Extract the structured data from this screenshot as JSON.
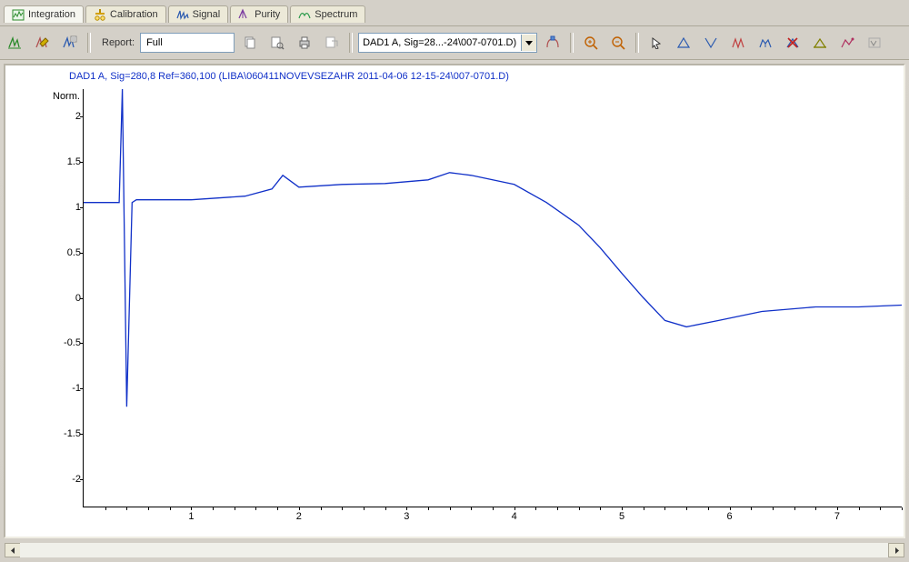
{
  "tabs": [
    {
      "label": "Integration",
      "active": true
    },
    {
      "label": "Calibration"
    },
    {
      "label": "Signal"
    },
    {
      "label": "Purity"
    },
    {
      "label": "Spectrum"
    }
  ],
  "toolbar": {
    "report_label": "Report:",
    "report_value": "Full",
    "signal_value": "DAD1 A, Sig=28...-24\\007-0701.D)"
  },
  "chart_title": "DAD1 A, Sig=280,8 Ref=360,100 (LIBA\\060411NOVEVSEZAHR 2011-04-06 12-15-24\\007-0701.D)",
  "ylabel": "Norm.",
  "chart_data": {
    "type": "line",
    "xlabel": "",
    "ylabel": "Norm.",
    "xlim": [
      0,
      7.6
    ],
    "ylim": [
      -2.3,
      2.3
    ],
    "xticks": [
      1,
      2,
      3,
      4,
      5,
      6,
      7
    ],
    "yticks": [
      -2,
      -1.5,
      -1,
      -0.5,
      0,
      0.5,
      1,
      1.5,
      2
    ],
    "series": [
      {
        "name": "DAD1 A",
        "color": "#1030c8",
        "x": [
          0.0,
          0.25,
          0.33,
          0.36,
          0.4,
          0.45,
          0.49,
          0.6,
          0.8,
          1.0,
          1.5,
          1.75,
          1.85,
          2.0,
          2.4,
          2.8,
          3.2,
          3.4,
          3.6,
          3.8,
          4.0,
          4.3,
          4.6,
          4.8,
          5.0,
          5.2,
          5.4,
          5.6,
          5.9,
          6.3,
          6.8,
          7.2,
          7.6
        ],
        "values": [
          1.05,
          1.05,
          1.05,
          2.3,
          -1.2,
          1.05,
          1.08,
          1.08,
          1.08,
          1.08,
          1.12,
          1.2,
          1.35,
          1.22,
          1.25,
          1.26,
          1.3,
          1.38,
          1.35,
          1.3,
          1.25,
          1.05,
          0.8,
          0.55,
          0.27,
          0.0,
          -0.25,
          -0.32,
          -0.25,
          -0.15,
          -0.1,
          -0.1,
          -0.08
        ]
      }
    ]
  }
}
